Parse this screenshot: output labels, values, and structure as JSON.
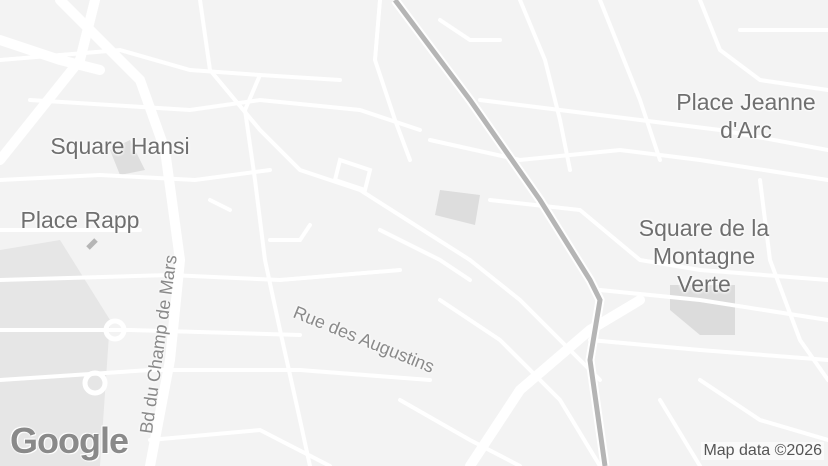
{
  "map": {
    "places": [
      {
        "id": "place-jeanne-darc",
        "lines": [
          "Place Jeanne",
          "d'Arc"
        ]
      },
      {
        "id": "square-hansi",
        "lines": [
          "Square Hansi"
        ]
      },
      {
        "id": "place-rapp",
        "lines": [
          "Place Rapp"
        ]
      },
      {
        "id": "square-montagne-verte",
        "lines": [
          "Square de la",
          "Montagne",
          "Verte"
        ]
      }
    ],
    "streets": [
      {
        "id": "rue-des-augustins",
        "label": "Rue des Augustins"
      },
      {
        "id": "bd-du-champ-de-mars",
        "label": "Bd du Champ de Mars"
      }
    ],
    "logo": "Google",
    "attribution": "Map data ©2026",
    "colors": {
      "background": "#f3f3f3",
      "road": "#ffffff",
      "railway": "#b5b5b5",
      "park": "#dcdcdc",
      "label": "#6f6f6f"
    }
  }
}
